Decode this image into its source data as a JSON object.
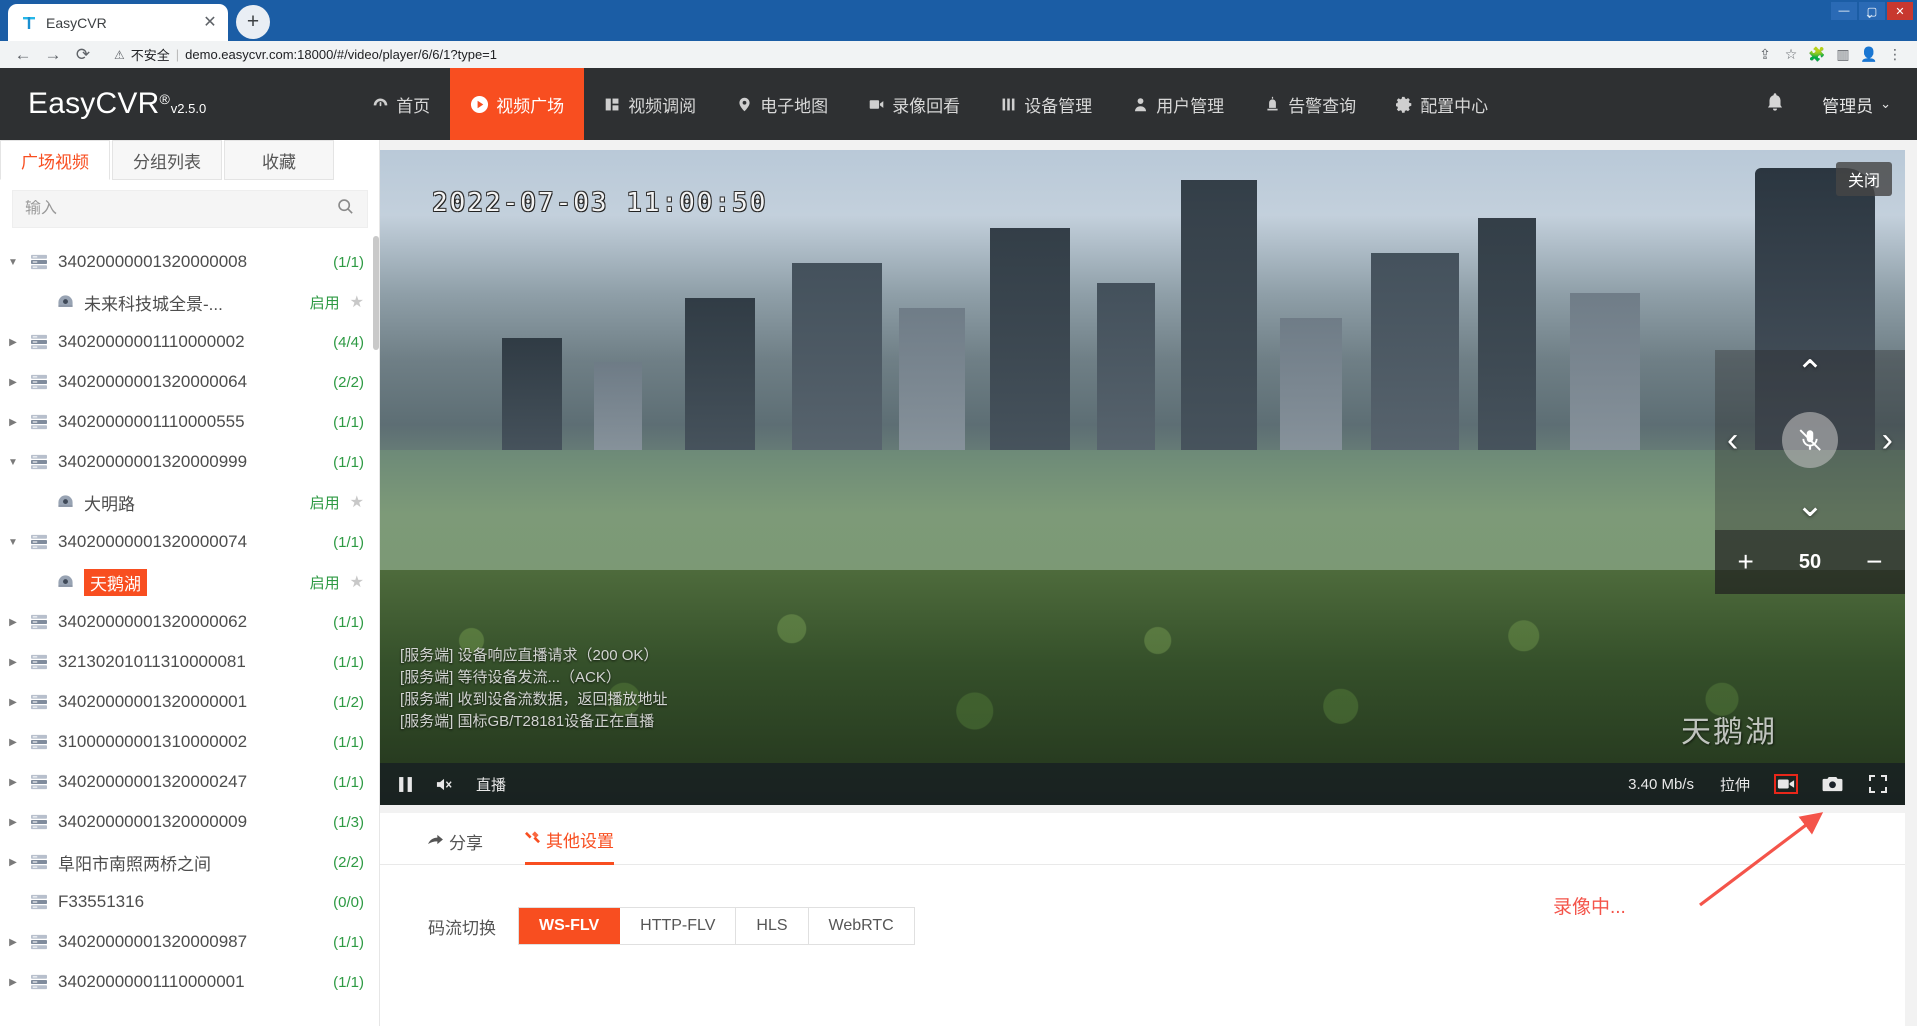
{
  "browser": {
    "tab_title": "EasyCVR",
    "tab_favicon_icon": "easycvr-favicon",
    "tab_close_icon": "close-icon",
    "newtab_icon": "plus-icon",
    "back_icon": "back-arrow-icon",
    "forward_icon": "forward-arrow-icon",
    "reload_icon": "reload-icon",
    "warning_icon": "warning-triangle-icon",
    "not_secure_label": "不安全",
    "url": "demo.easycvr.com:18000/#/video/player/6/6/1?type=1",
    "toolbar_icons": [
      "share-icon",
      "bookmark-star-icon",
      "extensions-puzzle-icon",
      "sidepanel-icon",
      "profile-avatar-icon",
      "chrome-menu-icon"
    ],
    "window_controls": [
      "minimize-icon",
      "maximize-icon",
      "close-window-icon"
    ],
    "chevron_down_icon": "chevron-down-icon"
  },
  "header": {
    "logo_main": "EasyCVR",
    "logo_registered": "®",
    "logo_version": "v2.5.0",
    "nav": [
      {
        "label": "首页",
        "icon": "dashboard-icon",
        "active": false
      },
      {
        "label": "视频广场",
        "icon": "play-circle-icon",
        "active": true
      },
      {
        "label": "视频调阅",
        "icon": "grid-panel-icon",
        "active": false
      },
      {
        "label": "电子地图",
        "icon": "map-pin-icon",
        "active": false
      },
      {
        "label": "录像回看",
        "icon": "video-playback-icon",
        "active": false
      },
      {
        "label": "设备管理",
        "icon": "device-bars-icon",
        "active": false
      },
      {
        "label": "用户管理",
        "icon": "user-icon",
        "active": false
      },
      {
        "label": "告警查询",
        "icon": "alarm-light-icon",
        "active": false
      },
      {
        "label": "配置中心",
        "icon": "gear-icon",
        "active": false
      }
    ],
    "bell_icon": "notification-bell-icon",
    "user_label": "管理员",
    "user_chevron_icon": "chevron-down-icon"
  },
  "sidebar": {
    "tabs": [
      {
        "label": "广场视频",
        "active": true
      },
      {
        "label": "分组列表",
        "active": false
      },
      {
        "label": "收藏",
        "active": false
      }
    ],
    "search": {
      "placeholder": "输入",
      "value": "",
      "icon": "search-icon"
    },
    "tree": [
      {
        "label": "34020000001320000008",
        "count": "(1/1)",
        "type": "device",
        "expanded": true,
        "icon": "device-bars-icon",
        "arrow": "caret-down-icon"
      },
      {
        "label": "未来科技城全景-...",
        "status": "启用",
        "type": "channel",
        "selected": false,
        "icon": "camera-dome-icon",
        "star_icon": "star-icon"
      },
      {
        "label": "34020000001110000002",
        "count": "(4/4)",
        "type": "device",
        "expanded": false,
        "icon": "device-bars-icon",
        "arrow": "caret-right-icon"
      },
      {
        "label": "34020000001320000064",
        "count": "(2/2)",
        "type": "device",
        "expanded": false,
        "icon": "device-bars-icon",
        "arrow": "caret-right-icon"
      },
      {
        "label": "34020000001110000555",
        "count": "(1/1)",
        "type": "device",
        "expanded": false,
        "icon": "device-bars-icon",
        "arrow": "caret-right-icon"
      },
      {
        "label": "34020000001320000999",
        "count": "(1/1)",
        "type": "device",
        "expanded": true,
        "icon": "device-bars-icon",
        "arrow": "caret-down-icon"
      },
      {
        "label": "大明路",
        "status": "启用",
        "type": "channel",
        "selected": false,
        "icon": "camera-dome-icon",
        "star_icon": "star-icon"
      },
      {
        "label": "34020000001320000074",
        "count": "(1/1)",
        "type": "device",
        "expanded": true,
        "icon": "device-bars-icon",
        "arrow": "caret-down-icon"
      },
      {
        "label": "天鹅湖",
        "status": "启用",
        "type": "channel",
        "selected": true,
        "icon": "camera-dome-icon",
        "star_icon": "star-icon"
      },
      {
        "label": "34020000001320000062",
        "count": "(1/1)",
        "type": "device",
        "expanded": false,
        "icon": "device-bars-icon",
        "arrow": "caret-right-icon"
      },
      {
        "label": "32130201011310000081",
        "count": "(1/1)",
        "type": "device",
        "expanded": false,
        "icon": "device-bars-icon",
        "arrow": "caret-right-icon"
      },
      {
        "label": "34020000001320000001",
        "count": "(1/2)",
        "type": "device",
        "expanded": false,
        "icon": "device-bars-icon",
        "arrow": "caret-right-icon"
      },
      {
        "label": "31000000001310000002",
        "count": "(1/1)",
        "type": "device",
        "expanded": false,
        "icon": "device-bars-icon",
        "arrow": "caret-right-icon"
      },
      {
        "label": "34020000001320000247",
        "count": "(1/1)",
        "type": "device",
        "expanded": false,
        "icon": "device-bars-icon",
        "arrow": "caret-right-icon"
      },
      {
        "label": "34020000001320000009",
        "count": "(1/3)",
        "type": "device",
        "expanded": false,
        "icon": "device-bars-icon",
        "arrow": "caret-right-icon"
      },
      {
        "label": "阜阳市南照两桥之间",
        "count": "(2/2)",
        "type": "device",
        "expanded": false,
        "icon": "device-bars-icon",
        "arrow": "caret-right-icon"
      },
      {
        "label": "F33551316",
        "count": "(0/0)",
        "type": "device",
        "expanded": false,
        "icon": "device-bars-icon",
        "arrow": ""
      },
      {
        "label": "34020000001320000987",
        "count": "(1/1)",
        "type": "device",
        "expanded": false,
        "icon": "device-bars-icon",
        "arrow": "caret-right-icon"
      },
      {
        "label": "34020000001110000001",
        "count": "(1/1)",
        "type": "device",
        "expanded": false,
        "icon": "device-bars-icon",
        "arrow": "caret-right-icon"
      }
    ]
  },
  "player": {
    "osd_timestamp": "2022-07-03 11:00:50",
    "osd_channel_name": "天鹅湖",
    "close_label": "关闭",
    "server_log": [
      "[服务端] 设备响应直播请求（200 OK）",
      "[服务端] 等待设备发流...（ACK）",
      "[服务端] 收到设备流数据，返回播放地址",
      "[服务端] 国标GB/T28181设备正在直播"
    ],
    "ptz": {
      "up_icon": "chevron-up-icon",
      "down_icon": "chevron-down-icon",
      "left_icon": "chevron-left-icon",
      "right_icon": "chevron-right-icon",
      "mic_icon": "microphone-muted-icon",
      "zoom_in_icon": "plus-icon",
      "zoom_out_icon": "minus-icon",
      "zoom_value": "50"
    },
    "controls": {
      "pause_icon": "pause-icon",
      "mute_icon": "speaker-muted-icon",
      "live_label": "直播",
      "bitrate": "3.40 Mb/s",
      "stretch_label": "拉伸",
      "record_icon": "record-camera-icon",
      "snapshot_icon": "snapshot-camera-icon",
      "fullscreen_icon": "fullscreen-icon"
    }
  },
  "bottom_panel": {
    "tabs": [
      {
        "label": "分享",
        "icon": "share-arrow-icon",
        "active": false
      },
      {
        "label": "其他设置",
        "icon": "wrench-icon",
        "active": true
      }
    ],
    "stream_label": "码流切换",
    "stream_options": [
      {
        "label": "WS-FLV",
        "active": true
      },
      {
        "label": "HTTP-FLV",
        "active": false
      },
      {
        "label": "HLS",
        "active": false
      },
      {
        "label": "WebRTC",
        "active": false
      }
    ]
  },
  "annotation": {
    "text": "录像中...",
    "color": "#f4544a"
  },
  "colors": {
    "accent": "#f84e20",
    "header_bg": "#2e3032",
    "browser_blue": "#1b5da5",
    "tree_count_green": "#2d9a43",
    "annotation_red": "#f4544a"
  }
}
